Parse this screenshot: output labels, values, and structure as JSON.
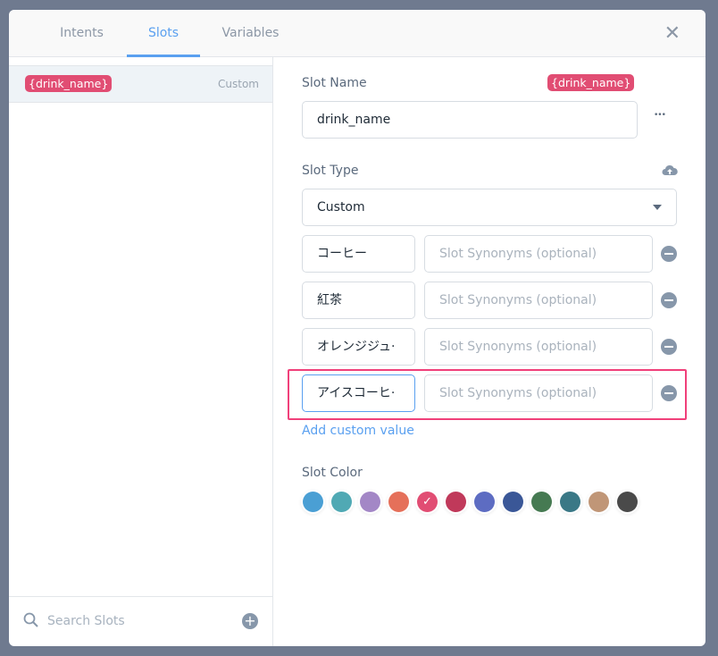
{
  "tabs": [
    {
      "label": "Intents"
    },
    {
      "label": "Slots"
    },
    {
      "label": "Variables"
    }
  ],
  "active_tab": "Slots",
  "sidebar": {
    "items": [
      {
        "name": "{drink_name}",
        "type": "Custom"
      }
    ],
    "search_placeholder": "Search Slots"
  },
  "form": {
    "slot_name_label": "Slot Name",
    "slot_chip": "{drink_name}",
    "slot_name_value": "drink_name",
    "more_label": "•••",
    "slot_type_label": "Slot Type",
    "slot_type_value": "Custom",
    "values": [
      {
        "value": "コーヒー",
        "synonyms_placeholder": "Slot Synonyms (optional)"
      },
      {
        "value": "紅茶",
        "synonyms_placeholder": "Slot Synonyms (optional)"
      },
      {
        "value": "オレンジジュ·",
        "synonyms_placeholder": "Slot Synonyms (optional)"
      },
      {
        "value": "アイスコーヒ·",
        "synonyms_placeholder": "Slot Synonyms (optional)"
      }
    ],
    "add_custom_value": "Add custom value",
    "slot_color_label": "Slot Color",
    "colors": [
      "#4a9fd4",
      "#50a9b4",
      "#a387c6",
      "#e5705a",
      "#e14d73",
      "#c0395a",
      "#5d6cc2",
      "#3a5797",
      "#467a52",
      "#3a7886",
      "#c09677",
      "#4a4a4a"
    ],
    "selected_color": "#e14d73"
  }
}
